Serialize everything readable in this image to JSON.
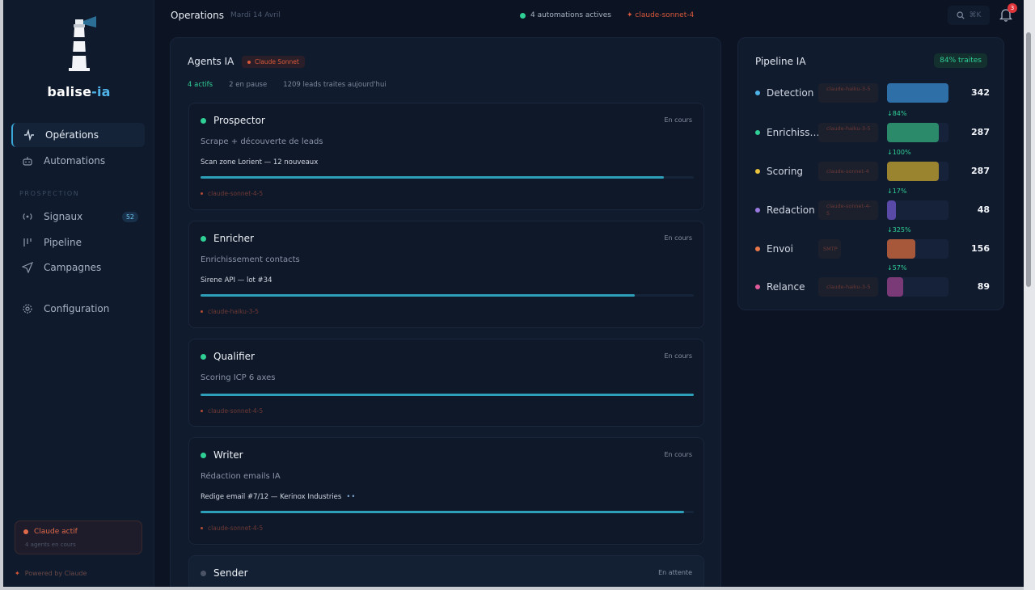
{
  "sidebar": {
    "brand_main": "balise",
    "brand_accent": "-ia",
    "nav": [
      {
        "label": "Opérations",
        "icon": "activity-icon"
      },
      {
        "label": "Automations",
        "icon": "robot-icon"
      },
      {
        "label": "Signaux",
        "icon": "signal-icon",
        "badge": "52"
      },
      {
        "label": "Pipeline",
        "icon": "columns-icon"
      },
      {
        "label": "Campagnes",
        "icon": "send-icon"
      },
      {
        "label": "Configuration",
        "icon": "gear-icon"
      }
    ],
    "section_label": "PROSPECTION",
    "claude_status": "Claude actif",
    "claude_sub": "4 agents en cours",
    "powered_by": "Powered by Claude"
  },
  "topbar": {
    "title": "Operations",
    "date": "Mardi 14 Avril",
    "automations": "4 automations actives",
    "model": "claude-sonnet-4",
    "shortcut": "⌘K",
    "notifications": "3"
  },
  "agents_panel": {
    "title": "Agents IA",
    "model_pill": "Claude Sonnet",
    "stats": {
      "active": "4 actifs",
      "paused": "2 en pause",
      "leads": "1209 leads traites aujourd'hui"
    },
    "agents": [
      {
        "name": "Prospector",
        "status": "En cours",
        "desc": "Scrape + découverte de leads",
        "task": "Scan zone Lorient — 12 nouveaux",
        "progress": 0.94,
        "model": "claude-sonnet-4-5"
      },
      {
        "name": "Enricher",
        "status": "En cours",
        "desc": "Enrichissement contacts",
        "task": "Sirene API — lot #34",
        "progress": 0.88,
        "model": "claude-haiku-3-5"
      },
      {
        "name": "Qualifier",
        "status": "En cours",
        "desc": "Scoring ICP 6 axes",
        "task": "",
        "progress": 1.0,
        "model": "claude-sonnet-4-5"
      },
      {
        "name": "Writer",
        "status": "En cours",
        "desc": "Rédaction emails IA",
        "task": "Redige email #7/12 — Kerinox Industries",
        "task_dots": "••",
        "progress": 0.98,
        "model": "claude-sonnet-4-5"
      },
      {
        "name": "Sender",
        "status": "En attente",
        "desc": "",
        "task": "",
        "progress": 0,
        "model": ""
      }
    ]
  },
  "pipeline_panel": {
    "title": "Pipeline IA",
    "percent": "84% traites",
    "steps": [
      {
        "label": "Detection",
        "model": "claude-haiku-3-5",
        "value": "342",
        "fill": 1.0,
        "color": "#2f6fa8",
        "dot": "#4fb3e8",
        "conversion": ""
      },
      {
        "label": "Enrichissement",
        "model": "claude-haiku-3-5",
        "value": "287",
        "fill": 0.84,
        "color": "#2a8a6a",
        "dot": "#2fcf95",
        "conversion": "↓84%"
      },
      {
        "label": "Scoring",
        "model": "claude-sonnet-4",
        "value": "287",
        "fill": 0.84,
        "color": "#9a8430",
        "dot": "#e8c23a",
        "conversion": "↓100%"
      },
      {
        "label": "Redaction",
        "model": "claude-sonnet-4-5",
        "value": "48",
        "fill": 0.14,
        "color": "#5a4aa8",
        "dot": "#9a7ae0",
        "conversion": "↓17%"
      },
      {
        "label": "Envoi",
        "model": "SMTP",
        "value": "156",
        "fill": 0.46,
        "color": "#a8583a",
        "dot": "#e8784a",
        "conversion": "↓325%"
      },
      {
        "label": "Relance",
        "model": "claude-haiku-3-5",
        "value": "89",
        "fill": 0.26,
        "color": "#7a3a78",
        "dot": "#e05a9a",
        "conversion": "↓57%"
      }
    ]
  }
}
